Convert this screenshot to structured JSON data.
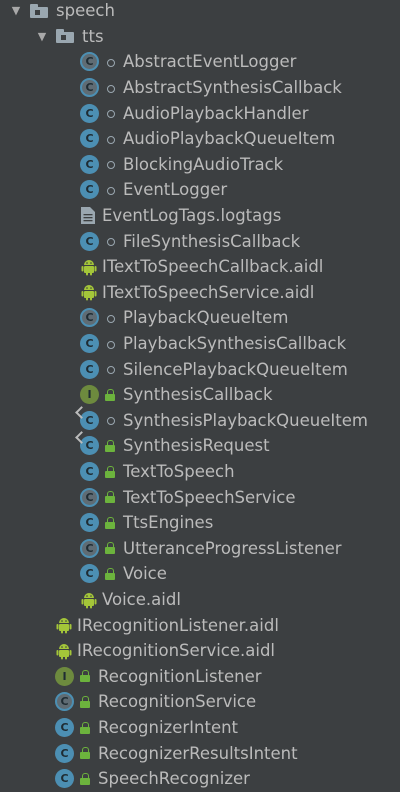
{
  "tree": {
    "rows": [
      {
        "label": "speech",
        "type": "folder",
        "expanded": true,
        "visibility": "none"
      },
      {
        "label": "tts",
        "type": "folder",
        "expanded": true,
        "visibility": "none"
      },
      {
        "label": "AbstractEventLogger",
        "type": "abstract-class",
        "visibility": "package"
      },
      {
        "label": "AbstractSynthesisCallback",
        "type": "abstract-class",
        "visibility": "package"
      },
      {
        "label": "AudioPlaybackHandler",
        "type": "class",
        "visibility": "package"
      },
      {
        "label": "AudioPlaybackQueueItem",
        "type": "class",
        "visibility": "package"
      },
      {
        "label": "BlockingAudioTrack",
        "type": "class",
        "visibility": "package"
      },
      {
        "label": "EventLogger",
        "type": "class",
        "visibility": "package"
      },
      {
        "label": "EventLogTags.logtags",
        "type": "file",
        "visibility": "none"
      },
      {
        "label": "FileSynthesisCallback",
        "type": "class",
        "visibility": "package"
      },
      {
        "label": "ITextToSpeechCallback.aidl",
        "type": "aidl",
        "visibility": "none"
      },
      {
        "label": "ITextToSpeechService.aidl",
        "type": "aidl",
        "visibility": "none"
      },
      {
        "label": "PlaybackQueueItem",
        "type": "abstract-class",
        "visibility": "package"
      },
      {
        "label": "PlaybackSynthesisCallback",
        "type": "class",
        "visibility": "package"
      },
      {
        "label": "SilencePlaybackQueueItem",
        "type": "class",
        "visibility": "package"
      },
      {
        "label": "SynthesisCallback",
        "type": "interface",
        "visibility": "public"
      },
      {
        "label": "SynthesisPlaybackQueueItem",
        "type": "class-pinned",
        "visibility": "package"
      },
      {
        "label": "SynthesisRequest",
        "type": "class-pinned",
        "visibility": "public"
      },
      {
        "label": "TextToSpeech",
        "type": "class",
        "visibility": "public"
      },
      {
        "label": "TextToSpeechService",
        "type": "abstract-class",
        "visibility": "public"
      },
      {
        "label": "TtsEngines",
        "type": "class",
        "visibility": "public"
      },
      {
        "label": "UtteranceProgressListener",
        "type": "abstract-class",
        "visibility": "public"
      },
      {
        "label": "Voice",
        "type": "class",
        "visibility": "public"
      },
      {
        "label": "Voice.aidl",
        "type": "aidl",
        "visibility": "none"
      },
      {
        "label": "IRecognitionListener.aidl",
        "type": "aidl",
        "visibility": "none"
      },
      {
        "label": "IRecognitionService.aidl",
        "type": "aidl",
        "visibility": "none"
      },
      {
        "label": "RecognitionListener",
        "type": "interface",
        "visibility": "public"
      },
      {
        "label": "RecognitionService",
        "type": "abstract-class",
        "visibility": "public"
      },
      {
        "label": "RecognizerIntent",
        "type": "class",
        "visibility": "public"
      },
      {
        "label": "RecognizerResultsIntent",
        "type": "class",
        "visibility": "public"
      },
      {
        "label": "SpeechRecognizer",
        "type": "class",
        "visibility": "public"
      }
    ]
  }
}
